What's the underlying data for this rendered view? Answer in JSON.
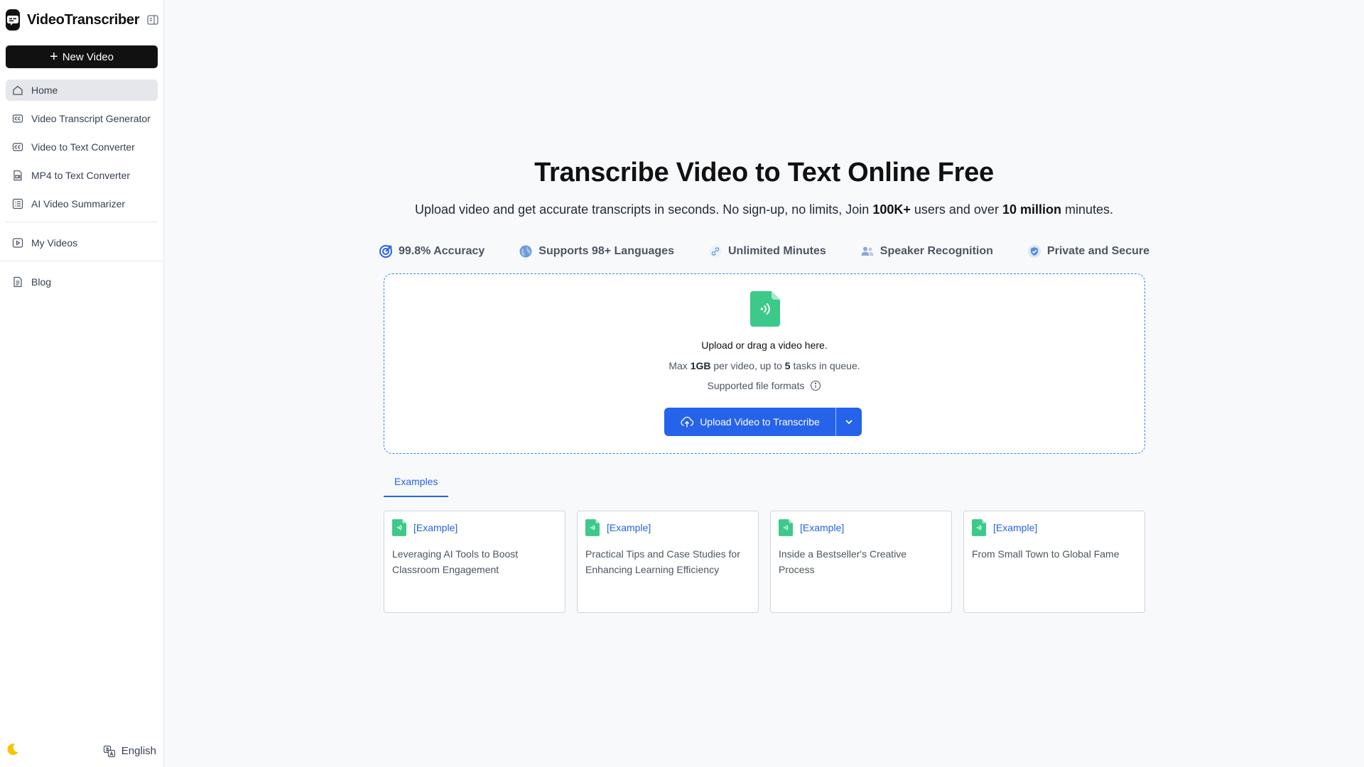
{
  "app": {
    "name": "VideoTranscriber",
    "new_video_label": "New Video"
  },
  "sidebar": {
    "items": [
      {
        "label": "Home",
        "icon": "home-icon",
        "active": true
      },
      {
        "label": "Video Transcript Generator",
        "icon": "cc-icon"
      },
      {
        "label": "Video to Text Converter",
        "icon": "cc-icon"
      },
      {
        "label": "MP4 to Text Converter",
        "icon": "file-video-icon"
      },
      {
        "label": "AI Video Summarizer",
        "icon": "list-icon"
      },
      {
        "label": "My Videos",
        "icon": "play-square-icon"
      },
      {
        "label": "Blog",
        "icon": "document-icon"
      }
    ],
    "language": "English"
  },
  "hero": {
    "title": "Transcribe Video to Text Online Free",
    "subtitle_a": "Upload video and get accurate transcripts in seconds. No sign-up, no limits, Join ",
    "subtitle_b": "100K+",
    "subtitle_c": " users and over ",
    "subtitle_d": "10 million",
    "subtitle_e": " minutes."
  },
  "features": [
    {
      "label": "99.8% Accuracy",
      "icon": "target-icon"
    },
    {
      "label": "Supports 98+ Languages",
      "icon": "globe-icon"
    },
    {
      "label": "Unlimited Minutes",
      "icon": "link-icon"
    },
    {
      "label": "Speaker Recognition",
      "icon": "users-icon"
    },
    {
      "label": "Private and Secure",
      "icon": "shield-icon"
    }
  ],
  "upload": {
    "drag_text": "Upload or drag a video here.",
    "limit_a": "Max ",
    "limit_b": "1GB",
    "limit_c": " per video, up to ",
    "limit_d": "5",
    "limit_e": " tasks in queue.",
    "formats_label": "Supported file formats",
    "button_label": "Upload Video to Transcribe"
  },
  "tabs": [
    "Examples"
  ],
  "examples": [
    {
      "tag": "[Example]",
      "title": "Leveraging AI Tools to Boost Classroom Engagement"
    },
    {
      "tag": "[Example]",
      "title": "Practical Tips and Case Studies for Enhancing Learning Efficiency"
    },
    {
      "tag": "[Example]",
      "title": "Inside a Bestseller's Creative Process"
    },
    {
      "tag": "[Example]",
      "title": "From Small Town to Global Fame"
    }
  ],
  "colors": {
    "accent": "#2563eb",
    "file_icon": "#3cc98a",
    "moon": "#f5c400"
  }
}
